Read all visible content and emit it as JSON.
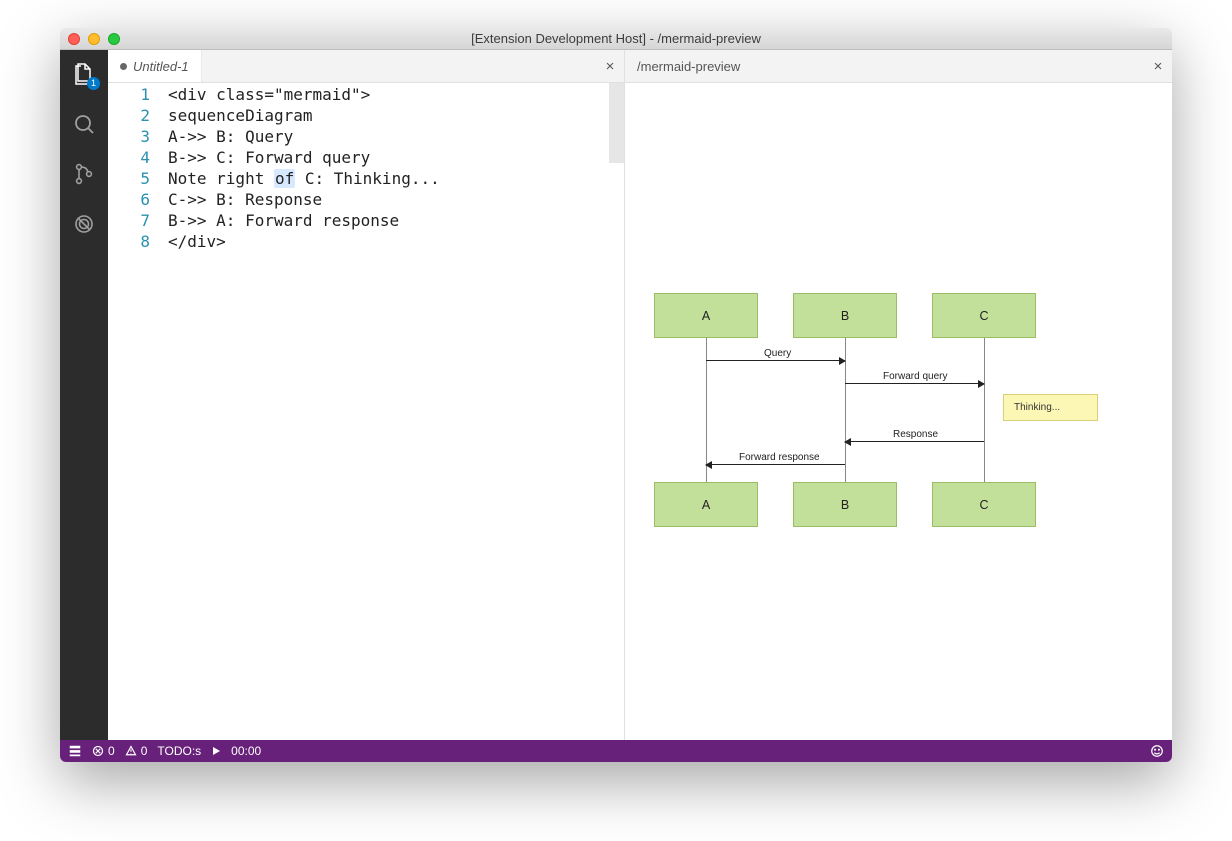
{
  "window_title": "[Extension Development Host] - /mermaid-preview",
  "activitybar": {
    "explorer_badge": "1"
  },
  "editor_left": {
    "tab_label": "Untitled-1",
    "lines": [
      "<div class=\"mermaid\">",
      "sequenceDiagram",
      "A->> B: Query",
      "B->> C: Forward query",
      "Note right of C: Thinking...",
      "C->> B: Response",
      "B->> A: Forward response",
      "</div>"
    ],
    "line_numbers": [
      "1",
      "2",
      "3",
      "4",
      "5",
      "6",
      "7",
      "8"
    ]
  },
  "editor_right": {
    "tab_label": "/mermaid-preview"
  },
  "diagram": {
    "actors": [
      "A",
      "B",
      "C"
    ],
    "messages": [
      {
        "label": "Query"
      },
      {
        "label": "Forward query"
      },
      {
        "label": "Response"
      },
      {
        "label": "Forward response"
      }
    ],
    "note": "Thinking..."
  },
  "statusbar": {
    "errors": "0",
    "warnings": "0",
    "todo": "TODO:s",
    "time": "00:00"
  },
  "chart_data": {
    "type": "sequence",
    "actors": [
      "A",
      "B",
      "C"
    ],
    "messages": [
      {
        "from": "A",
        "to": "B",
        "text": "Query"
      },
      {
        "from": "B",
        "to": "C",
        "text": "Forward query"
      },
      {
        "note": {
          "position": "right of",
          "actor": "C",
          "text": "Thinking..."
        }
      },
      {
        "from": "C",
        "to": "B",
        "text": "Response"
      },
      {
        "from": "B",
        "to": "A",
        "text": "Forward response"
      }
    ]
  }
}
